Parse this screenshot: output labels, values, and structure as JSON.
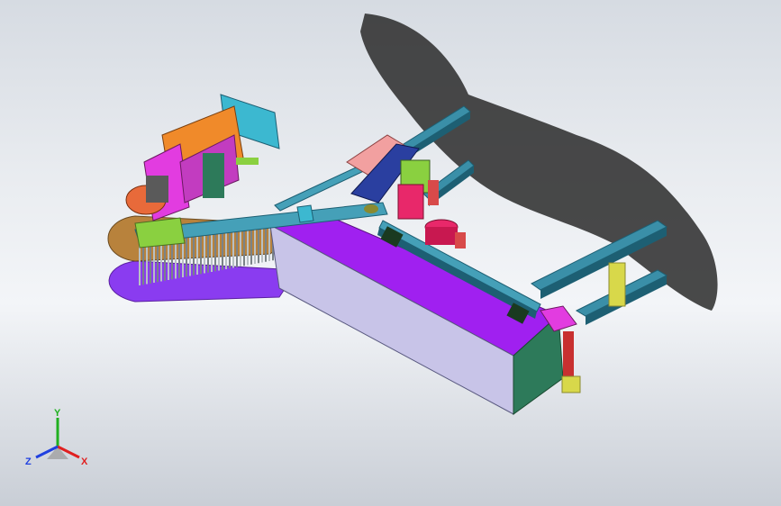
{
  "viewport": {
    "background_top": "#d6dbe2",
    "background_bottom": "#c9ced6"
  },
  "model": {
    "colors": {
      "rail": "#3a8fa8",
      "rail_dark": "#1d5f73",
      "box_top": "#a020f0",
      "box_front": "#c8c4e8",
      "box_end": "#2d7a5a",
      "base_plate": "#b8823c",
      "tray": "#8a3cf0",
      "bristle": "#9aa3a8",
      "motor": "#e86a3a",
      "bracket_orange": "#f08a2a",
      "bracket_magenta": "#e23ce0",
      "bracket_teal": "#3cb8d0",
      "pink_plate": "#f2a0a0",
      "blue_cylinder": "#2a3fa0",
      "yellow_block": "#d8d84a",
      "red_cylinder": "#e8286a",
      "green_block": "#8ad040",
      "shadow": "#2a2a2a"
    }
  },
  "triad": {
    "x_label": "X",
    "y_label": "Y",
    "z_label": "Z",
    "x_color": "#e02020",
    "y_color": "#20b020",
    "z_color": "#2040e0"
  }
}
